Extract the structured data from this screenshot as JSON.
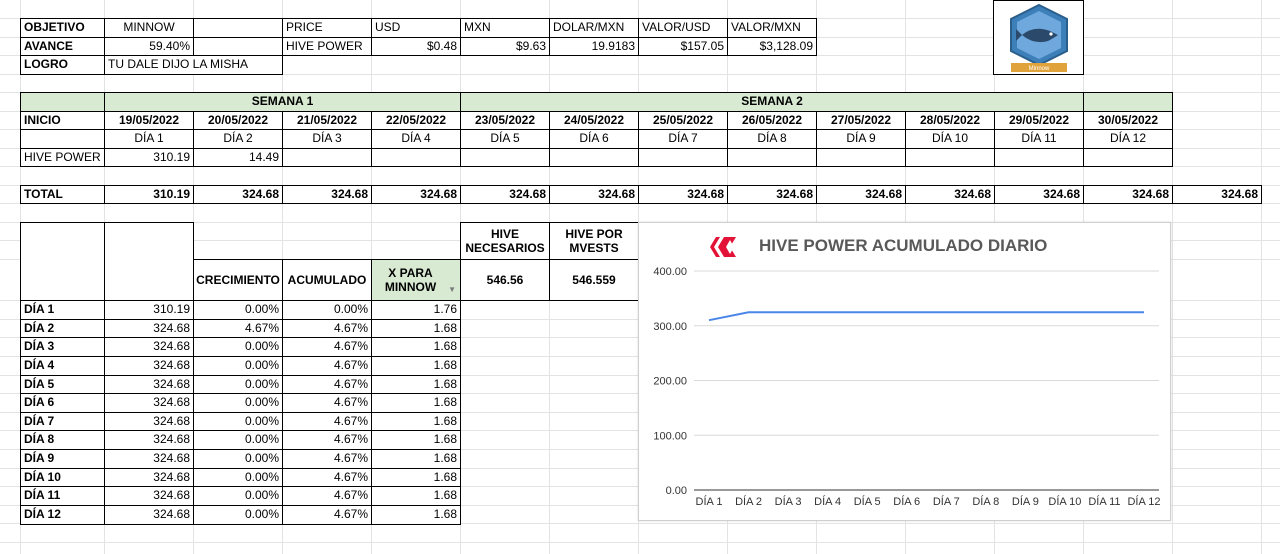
{
  "summary": {
    "objetivo_label": "OBJETIVO",
    "objetivo_value": "MINNOW",
    "avance_label": "AVANCE",
    "avance_value": "59.40%",
    "logro_label": "LOGRO",
    "logro_value": "TU DALE DIJO LA MISHA"
  },
  "prices": {
    "headers": [
      "PRICE",
      "USD",
      "MXN",
      "DOLAR/MXN",
      "VALOR/USD",
      "VALOR/MXN"
    ],
    "row_label": "HIVE POWER",
    "values": [
      "$0.48",
      "$9.63",
      "19.9183",
      "$157.05",
      "$3,128.09"
    ]
  },
  "logo": {
    "text": "Minnow",
    "accent": "#3d7fb8",
    "ribbon": "#e0a23a"
  },
  "schedule": {
    "week1": "SEMANA 1",
    "week2": "SEMANA 2",
    "inicio_label": "INICIO",
    "dates": [
      "19/05/2022",
      "20/05/2022",
      "21/05/2022",
      "22/05/2022",
      "23/05/2022",
      "24/05/2022",
      "25/05/2022",
      "26/05/2022",
      "27/05/2022",
      "28/05/2022",
      "29/05/2022",
      "30/05/2022"
    ],
    "days": [
      "DÍA 1",
      "DÍA 2",
      "DÍA 3",
      "DÍA 4",
      "DÍA 5",
      "DÍA 6",
      "DÍA 7",
      "DÍA 8",
      "DÍA 9",
      "DÍA 10",
      "DÍA 11",
      "DÍA 12"
    ],
    "hp_label": "HIVE POWER",
    "hp_values": [
      "310.19",
      "14.49",
      "",
      "",
      "",
      "",
      "",
      "",
      "",
      "",
      "",
      ""
    ],
    "total_label": "TOTAL",
    "totals": [
      "310.19",
      "324.68",
      "324.68",
      "324.68",
      "324.68",
      "324.68",
      "324.68",
      "324.68",
      "324.68",
      "324.68",
      "324.68",
      "324.68",
      "324.68"
    ]
  },
  "growth": {
    "headers": {
      "crecimiento": "CRECIMIENTO",
      "acumulado": "ACUMULADO",
      "x_para": "X PARA MINNOW"
    },
    "rows": [
      {
        "day": "DÍA 1",
        "hp": "310.19",
        "crec": "0.00%",
        "acum": "0.00%",
        "x": "1.76"
      },
      {
        "day": "DÍA 2",
        "hp": "324.68",
        "crec": "4.67%",
        "acum": "4.67%",
        "x": "1.68"
      },
      {
        "day": "DÍA 3",
        "hp": "324.68",
        "crec": "0.00%",
        "acum": "4.67%",
        "x": "1.68"
      },
      {
        "day": "DÍA 4",
        "hp": "324.68",
        "crec": "0.00%",
        "acum": "4.67%",
        "x": "1.68"
      },
      {
        "day": "DÍA 5",
        "hp": "324.68",
        "crec": "0.00%",
        "acum": "4.67%",
        "x": "1.68"
      },
      {
        "day": "DÍA 6",
        "hp": "324.68",
        "crec": "0.00%",
        "acum": "4.67%",
        "x": "1.68"
      },
      {
        "day": "DÍA 7",
        "hp": "324.68",
        "crec": "0.00%",
        "acum": "4.67%",
        "x": "1.68"
      },
      {
        "day": "DÍA 8",
        "hp": "324.68",
        "crec": "0.00%",
        "acum": "4.67%",
        "x": "1.68"
      },
      {
        "day": "DÍA 9",
        "hp": "324.68",
        "crec": "0.00%",
        "acum": "4.67%",
        "x": "1.68"
      },
      {
        "day": "DÍA 10",
        "hp": "324.68",
        "crec": "0.00%",
        "acum": "4.67%",
        "x": "1.68"
      },
      {
        "day": "DÍA 11",
        "hp": "324.68",
        "crec": "0.00%",
        "acum": "4.67%",
        "x": "1.68"
      },
      {
        "day": "DÍA 12",
        "hp": "324.68",
        "crec": "0.00%",
        "acum": "4.67%",
        "x": "1.68"
      }
    ]
  },
  "needed": {
    "hive_necesarios_label": "HIVE NECESARIOS",
    "hive_necesarios_value": "546.56",
    "hive_por_mvests_label": "HIVE POR MVESTS",
    "hive_por_mvests_value": "546.559"
  },
  "chart_data": {
    "type": "line",
    "title": "HIVE POWER ACUMULADO DIARIO",
    "categories": [
      "DÍA 1",
      "DÍA 2",
      "DÍA 3",
      "DÍA 4",
      "DÍA 5",
      "DÍA 6",
      "DÍA 7",
      "DÍA 8",
      "DÍA 9",
      "DÍA 10",
      "DÍA 11",
      "DÍA 12"
    ],
    "series": [
      {
        "values": [
          310.19,
          324.68,
          324.68,
          324.68,
          324.68,
          324.68,
          324.68,
          324.68,
          324.68,
          324.68,
          324.68,
          324.68
        ]
      }
    ],
    "yticks": [
      "0.00",
      "100.00",
      "200.00",
      "300.00",
      "400.00"
    ],
    "ylim": [
      0,
      400
    ],
    "grid": true,
    "line_color": "#4a86e8",
    "brand_color": "#e31337"
  }
}
